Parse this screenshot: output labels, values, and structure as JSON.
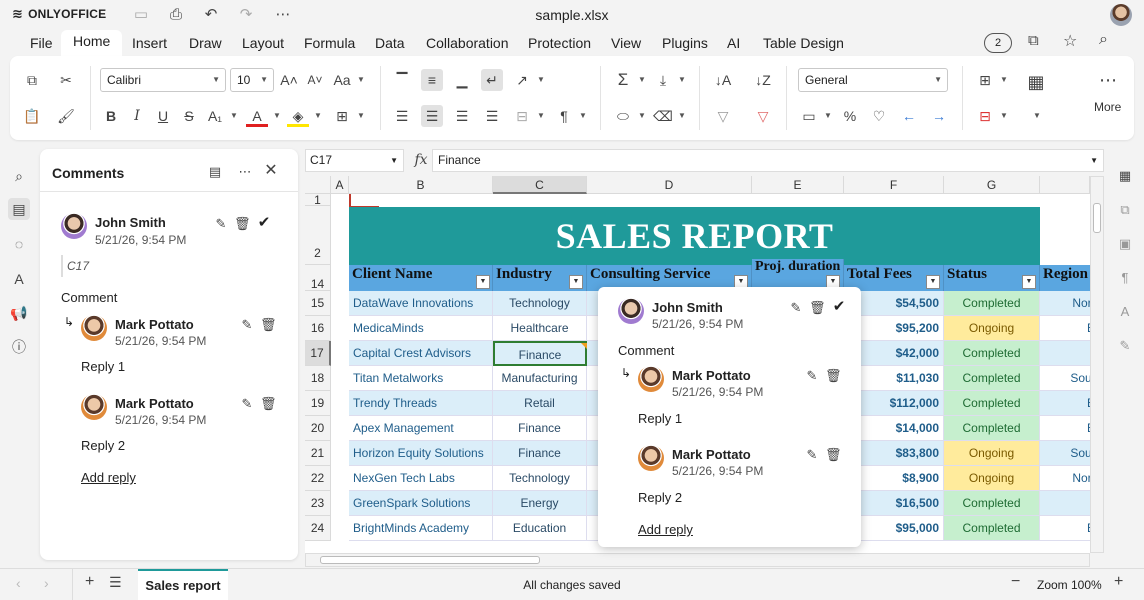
{
  "app": {
    "brand": "ONLYOFFICE",
    "doc_title": "sample.xlsx"
  },
  "menu": [
    "File",
    "Home",
    "Insert",
    "Draw",
    "Layout",
    "Formula",
    "Data",
    "Collaboration",
    "Protection",
    "View",
    "Plugins",
    "AI",
    "Table Design"
  ],
  "header_right": {
    "users_count": "2"
  },
  "toolbar": {
    "font_name": "Calibri",
    "font_size": "10",
    "number_format": "General",
    "more_label": "More"
  },
  "comments_panel": {
    "title": "Comments",
    "author": "John Smith",
    "date": "5/21/26, 9:54 PM",
    "cell_ref": "C17",
    "comment_text": "Comment",
    "replies": [
      {
        "author": "Mark Pottato",
        "date": "5/21/26, 9:54 PM",
        "text": "Reply 1"
      },
      {
        "author": "Mark Pottato",
        "date": "5/21/26, 9:54 PM",
        "text": "Reply 2"
      }
    ],
    "add_reply": "Add reply"
  },
  "formula_bar": {
    "name_box": "C17",
    "fx": "fx",
    "content": "Finance"
  },
  "sheet": {
    "columns": [
      "A",
      "B",
      "C",
      "D",
      "E",
      "F",
      "G"
    ],
    "rows": [
      "1",
      "2",
      "14",
      "15",
      "16",
      "17",
      "18",
      "19",
      "20",
      "21",
      "22",
      "23",
      "24"
    ],
    "banner": "SALES REPORT",
    "headers": [
      "Client Name",
      "Industry",
      "Consulting Service",
      "Proj. duration",
      "Total Fees",
      "Status",
      "Region"
    ],
    "data": [
      {
        "client": "DataWave Innovations",
        "industry": "Technology",
        "fees": "$54,500",
        "status": "Completed",
        "region": "Nort"
      },
      {
        "client": "MedicaMinds",
        "industry": "Healthcare",
        "fees": "$95,200",
        "status": "Ongoing",
        "region": "E"
      },
      {
        "client": "Capital Crest Advisors",
        "industry": "Finance",
        "fees": "$42,000",
        "status": "Completed",
        "region": ""
      },
      {
        "client": "Titan Metalworks",
        "industry": "Manufacturing",
        "fees": "$11,030",
        "status": "Completed",
        "region": "Sout"
      },
      {
        "client": "Trendy Threads",
        "industry": "Retail",
        "fees": "$112,000",
        "status": "Completed",
        "region": "E"
      },
      {
        "client": "Apex Management",
        "industry": "Finance",
        "fees": "$14,000",
        "status": "Completed",
        "region": "E"
      },
      {
        "client": "Horizon Equity Solutions",
        "industry": "Finance",
        "fees": "$83,800",
        "status": "Ongoing",
        "region": "Sout"
      },
      {
        "client": "NexGen Tech Labs",
        "industry": "Technology",
        "fees": "$8,900",
        "status": "Ongoing",
        "region": "Nort"
      },
      {
        "client": "GreenSpark Solutions",
        "industry": "Energy",
        "fees": "$16,500",
        "status": "Completed",
        "region": ""
      },
      {
        "client": "BrightMinds Academy",
        "industry": "Education",
        "fees": "$95,000",
        "status": "Completed",
        "region": "E"
      }
    ]
  },
  "status_bar": {
    "sheet_tab": "Sales report",
    "save_status": "All changes saved",
    "zoom": "Zoom 100%"
  },
  "colors": {
    "banner": "#1f9a9a",
    "header_blue": "#5aa6e0",
    "row_light": "#dbeef9",
    "completed": "#c6efce",
    "ongoing": "#ffeb9c"
  }
}
